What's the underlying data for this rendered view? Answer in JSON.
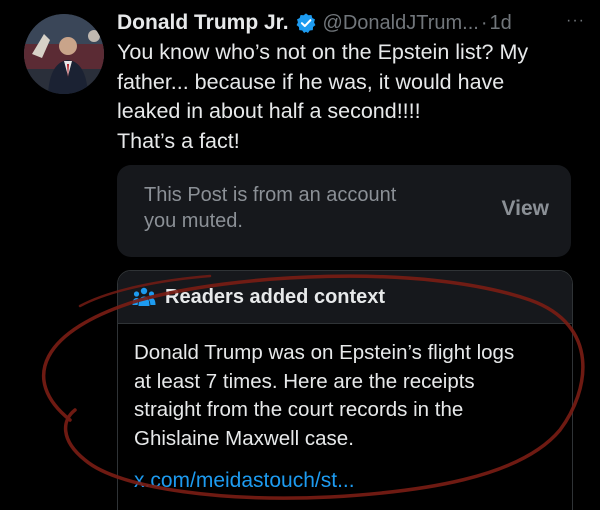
{
  "tweet": {
    "author": {
      "display_name": "Donald Trump Jr.",
      "handle": "@DonaldJTrum...",
      "separator": "·",
      "time": "1d",
      "verified_icon": "verified-badge-icon",
      "more_label": "···"
    },
    "text_lines": [
      "You know who’s not on the Epstein list? My",
      "father... because if he was, it would have",
      "leaked in about half a second!!!!",
      "That’s a fact!"
    ]
  },
  "muted_post": {
    "text_lines": [
      "This Post is from an account",
      "you muted."
    ],
    "view_label": "View"
  },
  "community_note": {
    "icon": "people-icon",
    "title": "Readers added context",
    "body_lines": [
      "Donald Trump was on Epstein’s flight logs",
      "at least 7 times. Here are the receipts",
      "straight from the court records in the",
      "Ghislaine Maxwell case."
    ],
    "link_text": "x.com/meidastouch/st..."
  },
  "colors": {
    "background": "#000000",
    "text_primary": "#e7e9ea",
    "text_secondary": "#71767b",
    "card_background": "#16181c",
    "link": "#1d9bf0",
    "verified": "#1d9bf0",
    "annotation_circle": "#7a1d14"
  }
}
